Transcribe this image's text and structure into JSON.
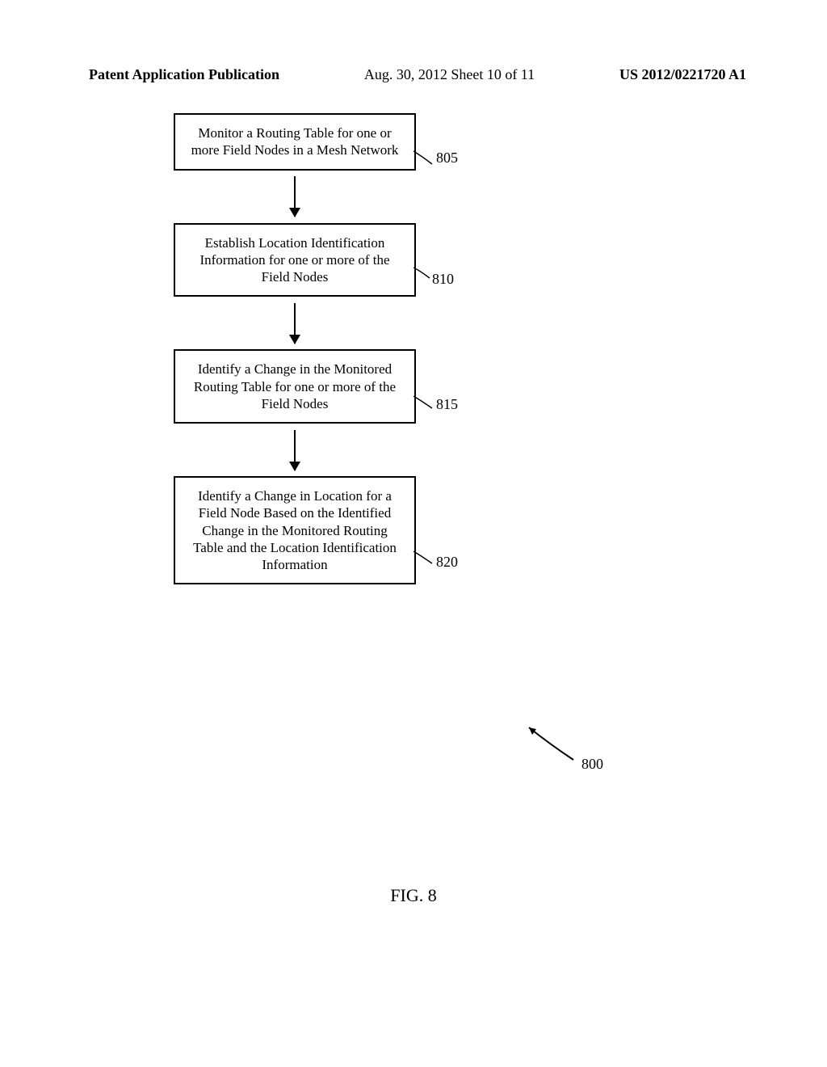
{
  "header": {
    "left": "Patent Application Publication",
    "center": "Aug. 30, 2012  Sheet 10 of 11",
    "right": "US 2012/0221720 A1"
  },
  "flowchart": {
    "box1": "Monitor a Routing Table for one or more Field Nodes in a Mesh Network",
    "box2": "Establish Location Identification Information for one or more of the Field Nodes",
    "box3": "Identify a Change in the Monitored Routing Table for one or more of the Field Nodes",
    "box4": "Identify a Change in Location for a Field Node Based on the Identified Change in the Monitored Routing Table and the Location Identification Information"
  },
  "refs": {
    "r805": "805",
    "r810": "810",
    "r815": "815",
    "r820": "820",
    "r800": "800"
  },
  "figure_label": "FIG.   8"
}
